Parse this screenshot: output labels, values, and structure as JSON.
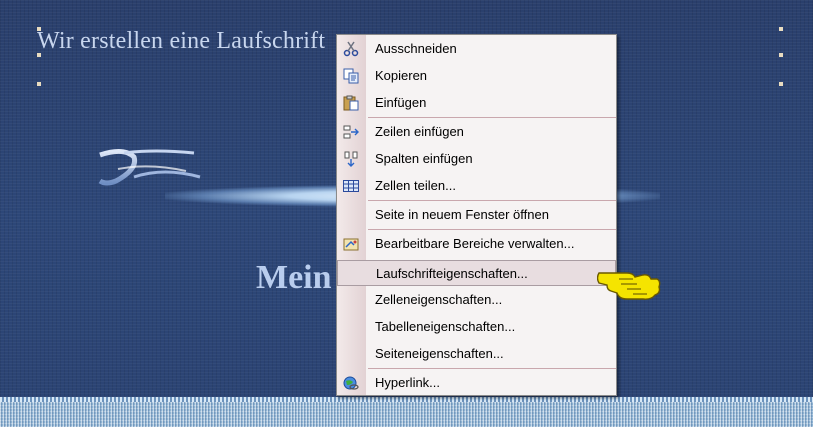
{
  "page": {
    "heading": "Wir erstellen eine Laufschrift",
    "marquee_text": "Mein",
    "logo_alt": "Kreativ Design",
    "bottom_border": "textured-border"
  },
  "context_menu": {
    "items": [
      {
        "label": "Ausschneiden",
        "icon": "scissors-icon"
      },
      {
        "label": "Kopieren",
        "icon": "copy-icon"
      },
      {
        "label": "Einfügen",
        "icon": "paste-icon"
      },
      {
        "label": "Zeilen einfügen",
        "icon": "insert-rows-icon"
      },
      {
        "label": "Spalten einfügen",
        "icon": "insert-columns-icon"
      },
      {
        "label": "Zellen teilen...",
        "icon": "split-cells-icon"
      },
      {
        "label": "Seite in neuem Fenster öffnen",
        "icon": ""
      },
      {
        "label": "Bearbeitbare Bereiche verwalten...",
        "icon": "editable-regions-icon"
      },
      {
        "label": "Laufschrifteigenschaften...",
        "icon": "",
        "highlighted": true
      },
      {
        "label": "Zelleneigenschaften...",
        "icon": ""
      },
      {
        "label": "Tabelleneigenschaften...",
        "icon": ""
      },
      {
        "label": "Seiteneigenschaften...",
        "icon": ""
      },
      {
        "label": "Hyperlink...",
        "icon": "hyperlink-globe-icon"
      }
    ]
  },
  "colors": {
    "background": "#2b4373",
    "heading": "#c8d6ee",
    "menu_background": "#f6f3f3",
    "highlight": "#e8dde0",
    "pointer_hand": "#f5e400"
  }
}
